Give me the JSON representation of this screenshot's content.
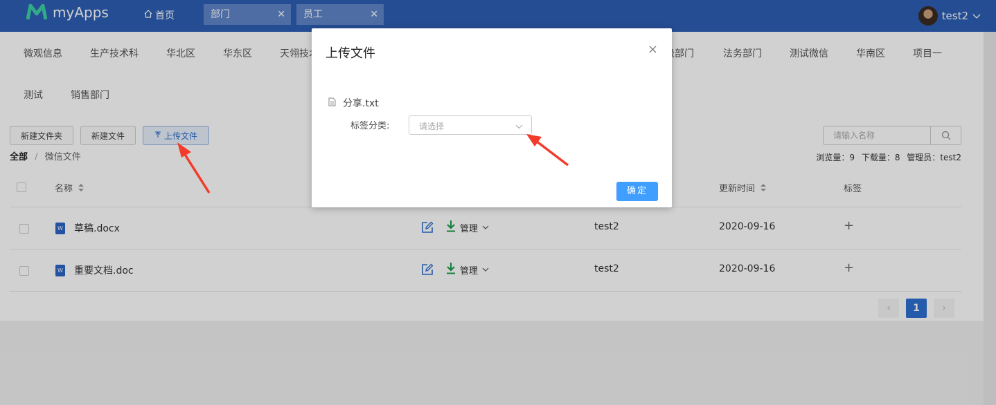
{
  "app": {
    "name": "myApps",
    "home_label": "首页"
  },
  "tabs": [
    {
      "label": "部门",
      "close": "✕"
    },
    {
      "label": "员工",
      "close": "✕"
    }
  ],
  "user": {
    "name": "test2"
  },
  "departments_row1": [
    "微观信息",
    "生产技术科",
    "华北区",
    "华东区",
    "天翎技术",
    "级部门",
    "法务部门",
    "测试微信",
    "华南区",
    "项目一"
  ],
  "departments_row2": [
    "测试",
    "销售部门"
  ],
  "toolbar": {
    "new_folder": "新建文件夹",
    "new_file": "新建文件",
    "upload": "上传文件"
  },
  "breadcrumb": {
    "root": "全部",
    "sep": "/",
    "current": "微信文件"
  },
  "search": {
    "placeholder": "请输入名称"
  },
  "stats": {
    "views_label": "浏览量：",
    "views": "9",
    "downloads_label": "下载量：",
    "downloads": "8",
    "admin_label": "管理员：",
    "admin": "test2"
  },
  "table": {
    "headers": {
      "name": "名称",
      "updated": "更新时间",
      "tags": "标签"
    },
    "rows": [
      {
        "name": "草稿.docx",
        "manage": "管理",
        "owner": "test2",
        "updated": "2020-09-16",
        "tag_add": "+"
      },
      {
        "name": "重要文档.doc",
        "manage": "管理",
        "owner": "test2",
        "updated": "2020-09-16",
        "tag_add": "+"
      }
    ]
  },
  "pagination": {
    "prev": "‹",
    "current": "1",
    "next": "›"
  },
  "modal": {
    "title": "上传文件",
    "close": "×",
    "file_name": "分享.txt",
    "tag_label": "标签分类:",
    "select_placeholder": "请选择",
    "confirm": "确定"
  },
  "colors": {
    "topbar": "#2d5fb4",
    "primary": "#409eff",
    "annotation": "#f23b2b"
  }
}
